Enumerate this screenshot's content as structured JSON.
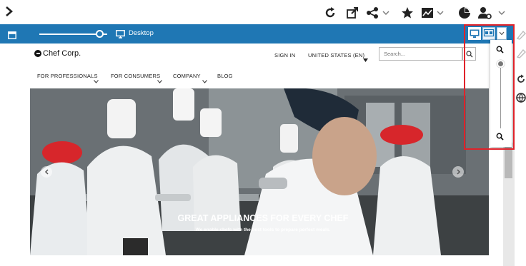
{
  "toolbar": {
    "icons": [
      "chevron-right-icon",
      "refresh-icon",
      "open-external-icon",
      "share-icon",
      "star-icon",
      "chart-icon",
      "pie-chart-icon",
      "user-settings-icon"
    ]
  },
  "device_bar": {
    "label": "Desktop",
    "slider_level": 0.88
  },
  "site": {
    "logo": "Chef Corp.",
    "sign_in": "SIGN IN",
    "region": "UNITED STATES (EN)",
    "search_placeholder": "Search...",
    "nav": [
      {
        "label": "FOR PROFESSIONALS"
      },
      {
        "label": "FOR CONSUMERS"
      },
      {
        "label": "COMPANY"
      },
      {
        "label": "BLOG"
      }
    ],
    "hero": {
      "title": "GREAT APPLIANCES FOR EVERY CHEF",
      "subtitle": "We enable chefs with the best tools to prepare perfect meals."
    }
  },
  "zoom": {
    "level": 0.05
  },
  "colors": {
    "accent": "#1f77b4",
    "highlight": "#e0222a",
    "chef_hat": "#d7262b"
  }
}
